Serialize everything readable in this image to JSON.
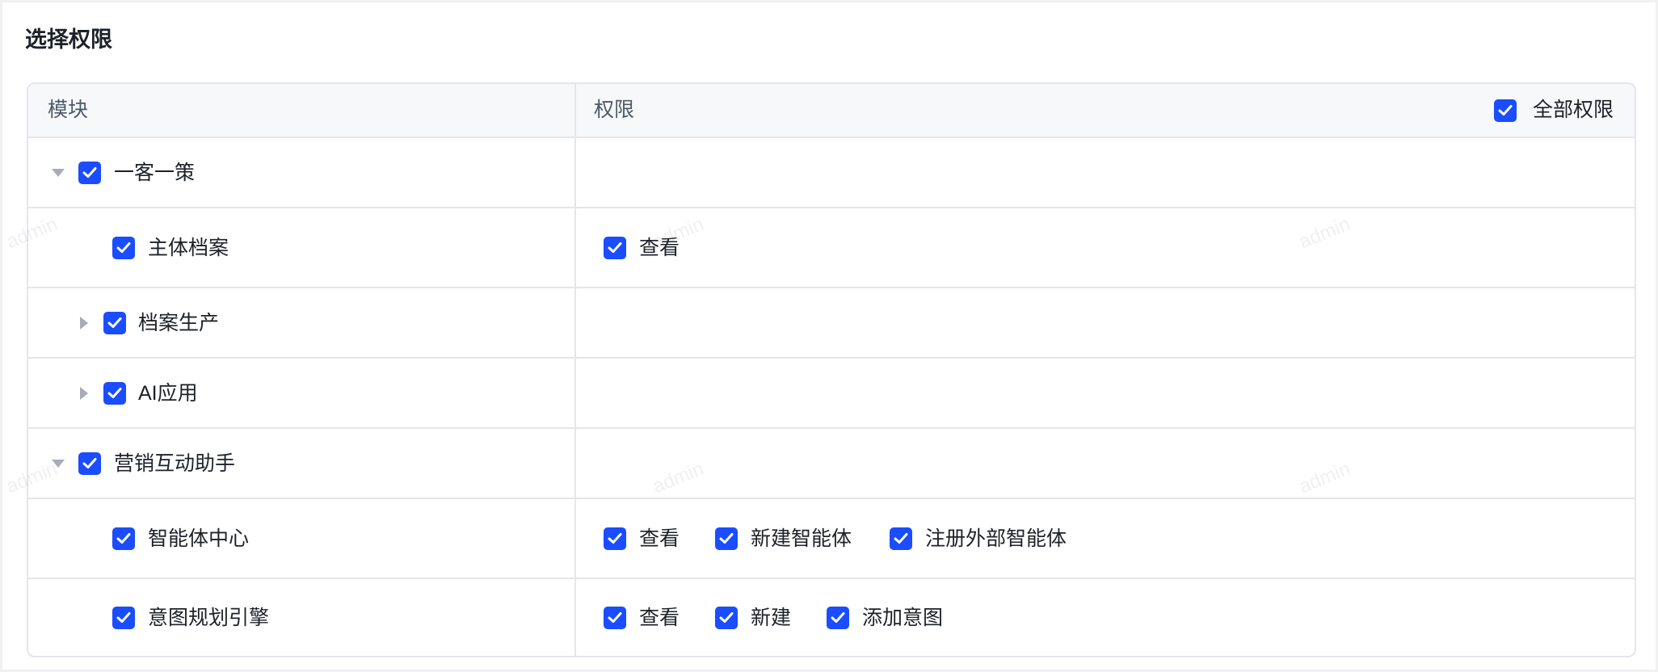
{
  "title": "选择权限",
  "header": {
    "module_label": "模块",
    "permission_label": "权限",
    "all_permissions_label": "全部权限",
    "all_permissions_checked": true
  },
  "rows": [
    {
      "label": "一客一策",
      "checked": true,
      "expander": "expanded",
      "permissions": []
    },
    {
      "label": "主体档案",
      "checked": true,
      "expander": "none",
      "permissions": [
        {
          "label": "查看",
          "checked": true
        }
      ]
    },
    {
      "label": "档案生产",
      "checked": true,
      "expander": "collapsed",
      "permissions": []
    },
    {
      "label": "AI应用",
      "checked": true,
      "expander": "collapsed",
      "permissions": []
    },
    {
      "label": "营销互动助手",
      "checked": true,
      "expander": "expanded",
      "permissions": []
    },
    {
      "label": "智能体中心",
      "checked": true,
      "expander": "none",
      "permissions": [
        {
          "label": "查看",
          "checked": true
        },
        {
          "label": "新建智能体",
          "checked": true
        },
        {
          "label": "注册外部智能体",
          "checked": true
        }
      ]
    },
    {
      "label": "意图规划引擎",
      "checked": true,
      "expander": "none",
      "permissions": [
        {
          "label": "查看",
          "checked": true
        },
        {
          "label": "新建",
          "checked": true
        },
        {
          "label": "添加意图",
          "checked": true
        }
      ]
    }
  ],
  "watermark_text": "admin",
  "colors": {
    "accent": "#1a4dff",
    "border": "#e5e6eb",
    "header_bg": "#f7f8fa",
    "text": "#1d2129"
  }
}
